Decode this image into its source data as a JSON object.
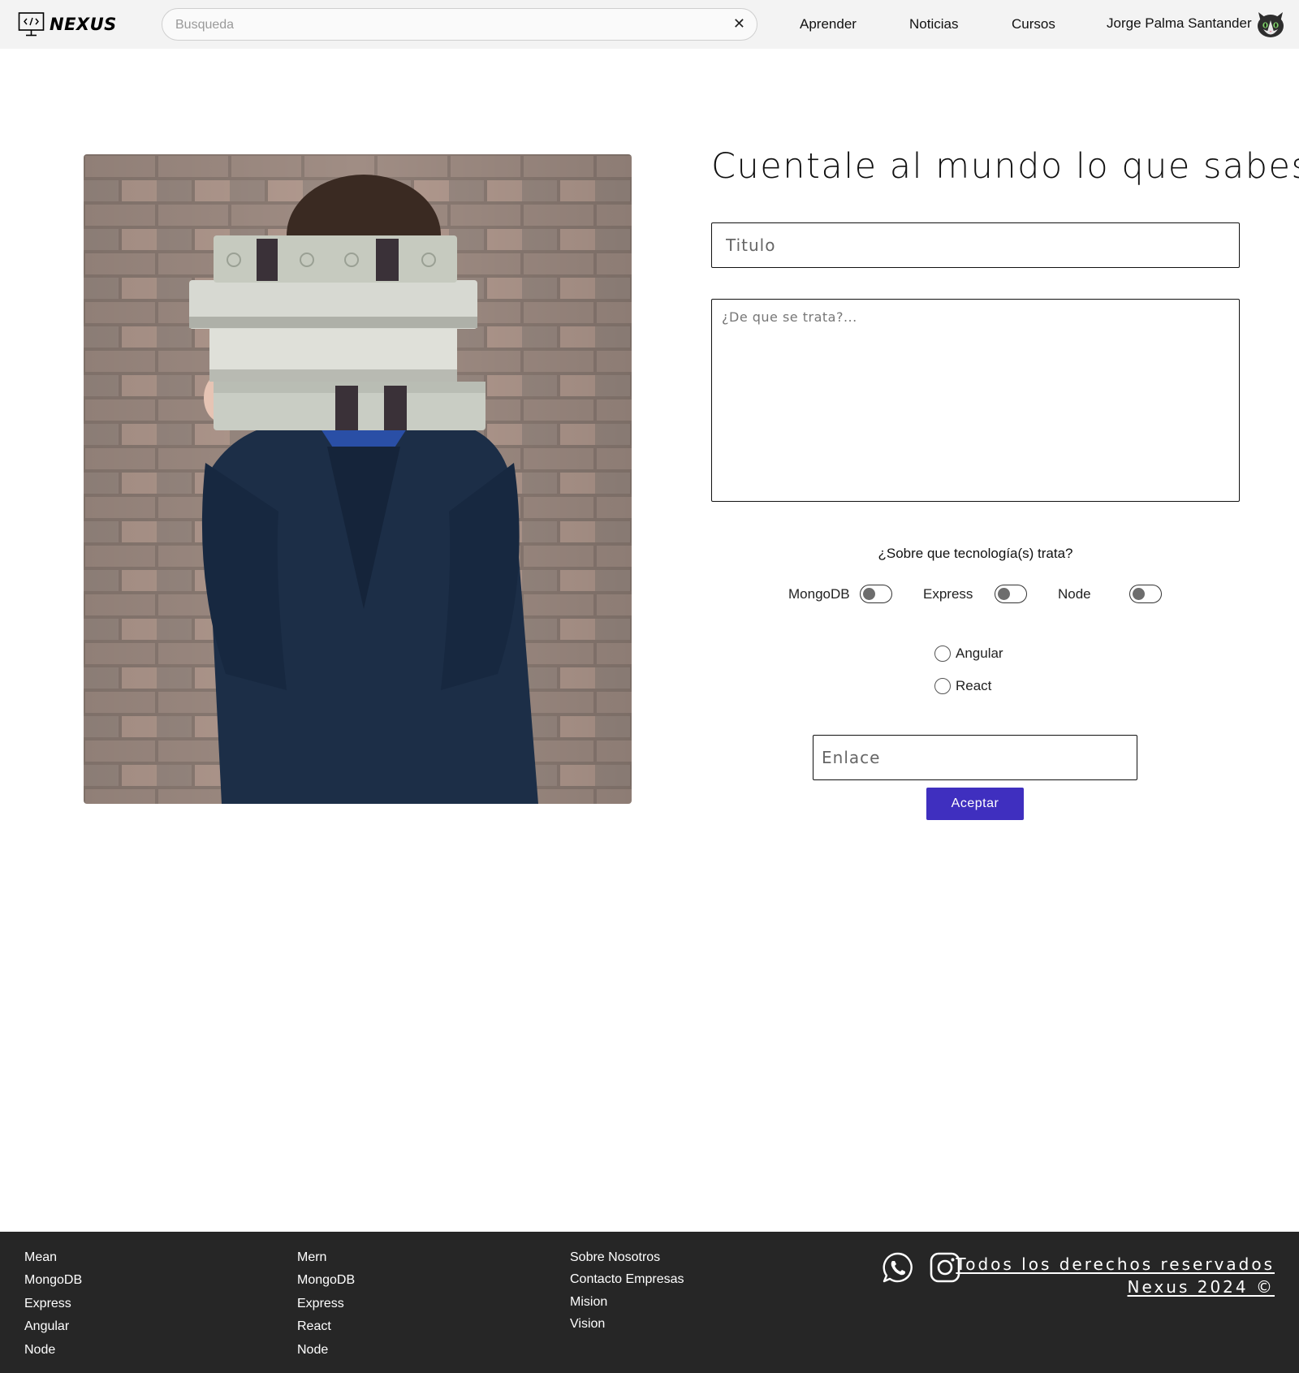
{
  "header": {
    "brand": "NEXUS",
    "search_placeholder": "Busqueda",
    "search_clear": "✕",
    "nav": [
      "Aprender",
      "Noticias",
      "Cursos"
    ],
    "user_name": "Jorge Palma Santander"
  },
  "form": {
    "heading": "Cuentale al mundo lo que sabes",
    "title_placeholder": "Titulo",
    "description_placeholder": "¿De que se trata?...",
    "tech_question": "¿Sobre que tecnología(s) trata?",
    "toggles": [
      {
        "label": "MongoDB",
        "on": false
      },
      {
        "label": "Express",
        "on": false
      },
      {
        "label": "Node",
        "on": false
      }
    ],
    "radios": [
      {
        "label": "Angular",
        "checked": false
      },
      {
        "label": "React",
        "checked": false
      }
    ],
    "link_placeholder": "Enlace",
    "submit_label": "Aceptar"
  },
  "footer": {
    "col1": [
      "Mean",
      "MongoDB",
      "Express",
      "Angular",
      "Node"
    ],
    "col2": [
      "Mern",
      "MongoDB",
      "Express",
      "React",
      "Node"
    ],
    "col3": [
      "Sobre Nosotros",
      "Contacto Empresas",
      "Mision",
      "Vision"
    ],
    "social": [
      "whatsapp-icon",
      "instagram-icon"
    ],
    "rights_line1": "Todos los derechos reservados",
    "rights_line2": "Nexus 2024 ©"
  },
  "colors": {
    "header_bg": "#f3f3f3",
    "footer_bg": "#262626",
    "accent": "#3f2fbf"
  }
}
